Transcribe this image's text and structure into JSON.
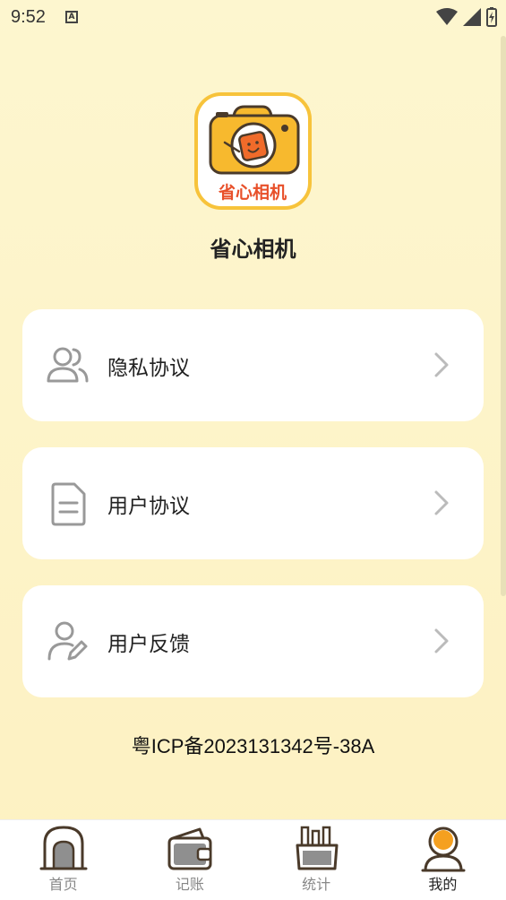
{
  "status_bar": {
    "time": "9:52",
    "notification_glyph": "A"
  },
  "app": {
    "logo_text": "省心相机",
    "name": "省心相机"
  },
  "menu": [
    {
      "label": "隐私协议",
      "icon": "users-icon"
    },
    {
      "label": "用户协议",
      "icon": "document-icon"
    },
    {
      "label": "用户反馈",
      "icon": "user-edit-icon"
    }
  ],
  "footer": {
    "icp": "粤ICP备2023131342号-38A"
  },
  "tabs": [
    {
      "label": "首页",
      "icon": "home-door-icon",
      "active": false
    },
    {
      "label": "记账",
      "icon": "wallet-icon",
      "active": false
    },
    {
      "label": "统计",
      "icon": "pencil-cup-icon",
      "active": false
    },
    {
      "label": "我的",
      "icon": "profile-icon",
      "active": true
    }
  ],
  "colors": {
    "accent": "#f7c33b",
    "logo_text": "#e8502a",
    "background": "#fdf6cf"
  }
}
